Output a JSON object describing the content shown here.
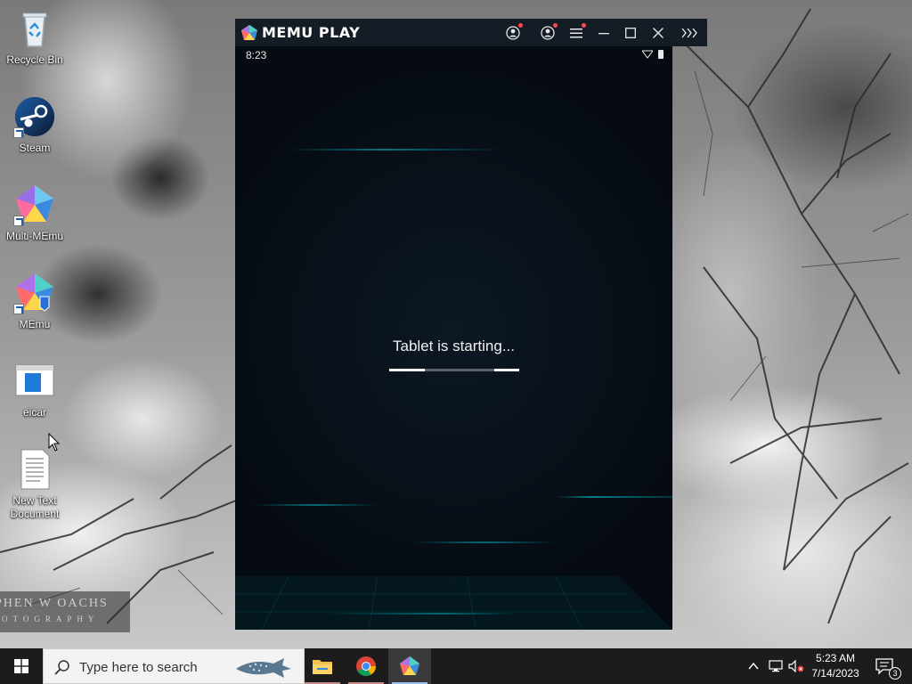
{
  "desktop": {
    "icons": [
      {
        "label": "Recycle Bin"
      },
      {
        "label": "Steam"
      },
      {
        "label": "Multi-MEmu"
      },
      {
        "label": "MEmu"
      },
      {
        "label": "eicar"
      },
      {
        "label": "New Text Document"
      }
    ],
    "watermark": {
      "line1": "PHEN W OACHS",
      "line2": "OTOGRAPHY"
    }
  },
  "memu": {
    "title": "MEMU PLAY",
    "status_time": "8:23",
    "boot_message": "Tablet is starting...",
    "accent_color": "#00c8d8"
  },
  "taskbar": {
    "search_placeholder": "Type here to search",
    "clock_time": "5:23 AM",
    "clock_date": "7/14/2023",
    "notification_count": "3"
  }
}
